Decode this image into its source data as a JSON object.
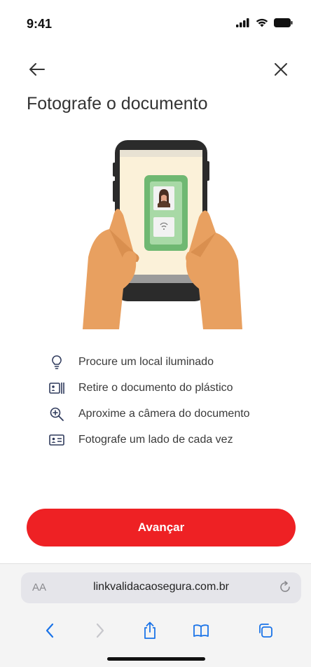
{
  "status": {
    "time": "9:41"
  },
  "page": {
    "title": "Fotografe o documento"
  },
  "tips": [
    {
      "icon": "lightbulb-icon",
      "text": "Procure um local iluminado"
    },
    {
      "icon": "id-card-out-of-sleeve-icon",
      "text": "Retire o documento do plástico"
    },
    {
      "icon": "zoom-in-icon",
      "text": "Aproxime a câmera do documento"
    },
    {
      "icon": "id-card-icon",
      "text": "Fotografe um lado de cada vez"
    }
  ],
  "actions": {
    "next_label": "Avançar"
  },
  "browser": {
    "aa_label": "AA",
    "url": "linkvalidacaosegura.com.br"
  },
  "colors": {
    "accent": "#ee2124",
    "icon": "#2f3a5c",
    "card_green": "#7bc47f"
  }
}
